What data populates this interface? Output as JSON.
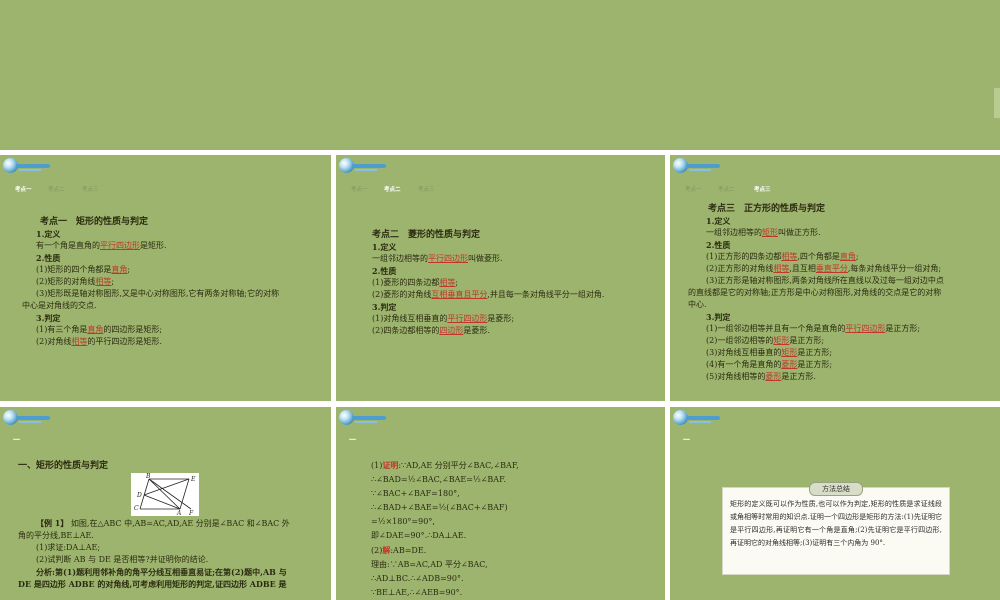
{
  "nav": {
    "tab1": "考点一",
    "tab2": "考点二",
    "tab3": "考点三",
    "dash": "一"
  },
  "slide1": {
    "title": "考点一　矩形的性质与判定",
    "def_h": "1.定义",
    "def_a": "有一个角是直角的",
    "def_hl": "平行四边形",
    "def_b": "是矩形.",
    "prop_h": "2.性质",
    "p1_a": "(1)矩形的四个角都是",
    "p1_hl": "直角",
    "p1_b": ";",
    "p2_a": "(2)矩形的对角线",
    "p2_hl": "相等",
    "p2_b": ";",
    "p3_a": "(3)矩形既是轴对称图形,又是中心对称图形,它有两条对称轴;它的对称",
    "p3_b": "中心是对角线的交点.",
    "judge_h": "3.判定",
    "j1_a": "(1)有三个角是",
    "j1_hl": "直角",
    "j1_b": "的四边形是矩形;",
    "j2_a": "(2)对角线",
    "j2_hl": "相等",
    "j2_b": "的平行四边形是矩形."
  },
  "slide2": {
    "title": "考点二　菱形的性质与判定",
    "def_h": "1.定义",
    "def_a": "一组邻边相等的",
    "def_hl": "平行四边形",
    "def_b": "叫做菱形.",
    "prop_h": "2.性质",
    "p1_a": "(1)菱形的四条边都",
    "p1_hl": "相等",
    "p1_b": ";",
    "p2_a": "(2)菱形的对角线",
    "p2_hl": "互相垂直且平分",
    "p2_b": ",并且每一条对角线平分一组对角.",
    "judge_h": "3.判定",
    "j1_a": "(1)对角线互相垂直的",
    "j1_hl": "平行四边形",
    "j1_b": "是菱形;",
    "j2_a": "(2)四条边都相等的",
    "j2_hl": "四边形",
    "j2_b": "是菱形."
  },
  "slide3": {
    "title": "考点三　正方形的性质与判定",
    "def_h": "1.定义",
    "def_a": "一组邻边相等的",
    "def_hl": "矩形",
    "def_b": "叫做正方形.",
    "prop_h": "2.性质",
    "p1_a": "(1)正方形的四条边都",
    "p1_hl1": "相等",
    "p1_m": ",四个角都是",
    "p1_hl2": "直角",
    "p1_b": ";",
    "p2_a": "(2)正方形的对角线",
    "p2_hl1": "相等",
    "p2_m": ",且互相",
    "p2_hl2": "垂直平分",
    "p2_b": ",每条对角线平分一组对角;",
    "p3_a": "(3)正方形是轴对称图形,两条对角线所在直线以及过每一组对边中点",
    "p3_b": "的直线都是它的对称轴;正方形是中心对称图形,对角线的交点是它的对称",
    "p3_c": "中心.",
    "judge_h": "3.判定",
    "j1_a": "(1)一组邻边相等并且有一个角是直角的",
    "j1_hl": "平行四边形",
    "j1_b": "是正方形;",
    "j2_a": "(2)一组邻边相等的",
    "j2_hl": "矩形",
    "j2_b": "是正方形;",
    "j3_a": "(3)对角线互相垂直的",
    "j3_hl": "矩形",
    "j3_b": "是正方形;",
    "j4_a": "(4)有一个角是直角的",
    "j4_hl": "菱形",
    "j4_b": "是正方形;",
    "j5_a": "(5)对角线相等的",
    "j5_hl": "菱形",
    "j5_b": "是正方形."
  },
  "slide4": {
    "section": "一、矩形的性质与判定",
    "fig": {
      "B": "B",
      "E": "E",
      "D": "D",
      "C": "C",
      "A": "A",
      "F": "F"
    },
    "ex_h": "【例 1】",
    "ex_a": " 如图,在△ABC 中,AB=AC,AD,AE 分别是∠BAC 和∠BAC 外",
    "ex_b": "角的平分线,BE⊥AE.",
    "q1": "(1)求证:DA⊥AE;",
    "q2": "(2)试判断 AB 与 DE 是否相等?并证明你的结论.",
    "an_a": "分析:第(1)题利用邻补角的角平分线互相垂直易证;在第(2)题中,AB 与",
    "an_b": "DE 是四边形 ADBE 的对角线,可考虑利用矩形的判定,证四边形 ADBE 是"
  },
  "slide5": {
    "l1_a": "(1)",
    "l1_hl": "证明",
    "l1_b": ":∵AD,AE 分别平分∠BAC,∠BAF,",
    "l2": "∴∠BAD=½∠BAC,∠BAE=½∠BAF.",
    "l3": "∵∠BAC+∠BAF=180°,",
    "l4": "∴∠BAD+∠BAE=½(∠BAC+∠BAF)",
    "l5": "=½×180°=90°,",
    "l6": "即∠DAE=90°.∴DA⊥AE.",
    "l7_a": "(2)",
    "l7_hl": "解",
    "l7_b": ":AB=DE.",
    "l8": "理由:∵AB=AC,AD 平分∠BAC,",
    "l9": "∴AD⊥BC.∴∠ADB=90°.",
    "l10": "∵BE⊥AE,∴∠AEB=90°."
  },
  "slide6": {
    "box_title": "方法总结",
    "box_text": "矩形的定义既可以作为性质,也可以作为判定,矩形的性质是求证线段或角相等时常用的知识点.证明一个四边形是矩形的方法:(1)先证明它是平行四边形,再证明它有一个角是直角;(2)先证明它是平行四边形,再证明它的对角线相等;(3)证明有三个内角为 90°."
  },
  "colors": {
    "slide_bg": "#9db46e",
    "highlight": "#c0362c",
    "text": "#2b2b10",
    "nav_active": "#ffffff",
    "nav_inactive": "#7f9660"
  }
}
